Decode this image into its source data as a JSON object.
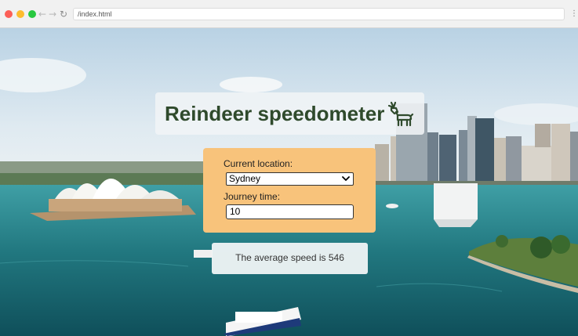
{
  "browser": {
    "address": "/index.html",
    "back_icon": "arrow-left-icon",
    "forward_icon": "arrow-right-icon",
    "reload_icon": "reload-icon",
    "menu_icon": "kebab-menu-icon",
    "back_glyph": "←",
    "forward_glyph": "→",
    "reload_glyph": "↻",
    "menu_glyph": "⋮"
  },
  "page": {
    "title": "Reindeer speedometer",
    "title_icon": "reindeer-icon",
    "background": "sydney-harbour-photo"
  },
  "form": {
    "location_label": "Current location:",
    "location_value": "Sydney",
    "time_label": "Journey time:",
    "time_value": "10"
  },
  "result": {
    "text": "The average speed is 546"
  },
  "colors": {
    "title": "#2f4a2c",
    "form_background": "#f8c37b",
    "card_background": "#f0f4f6"
  }
}
